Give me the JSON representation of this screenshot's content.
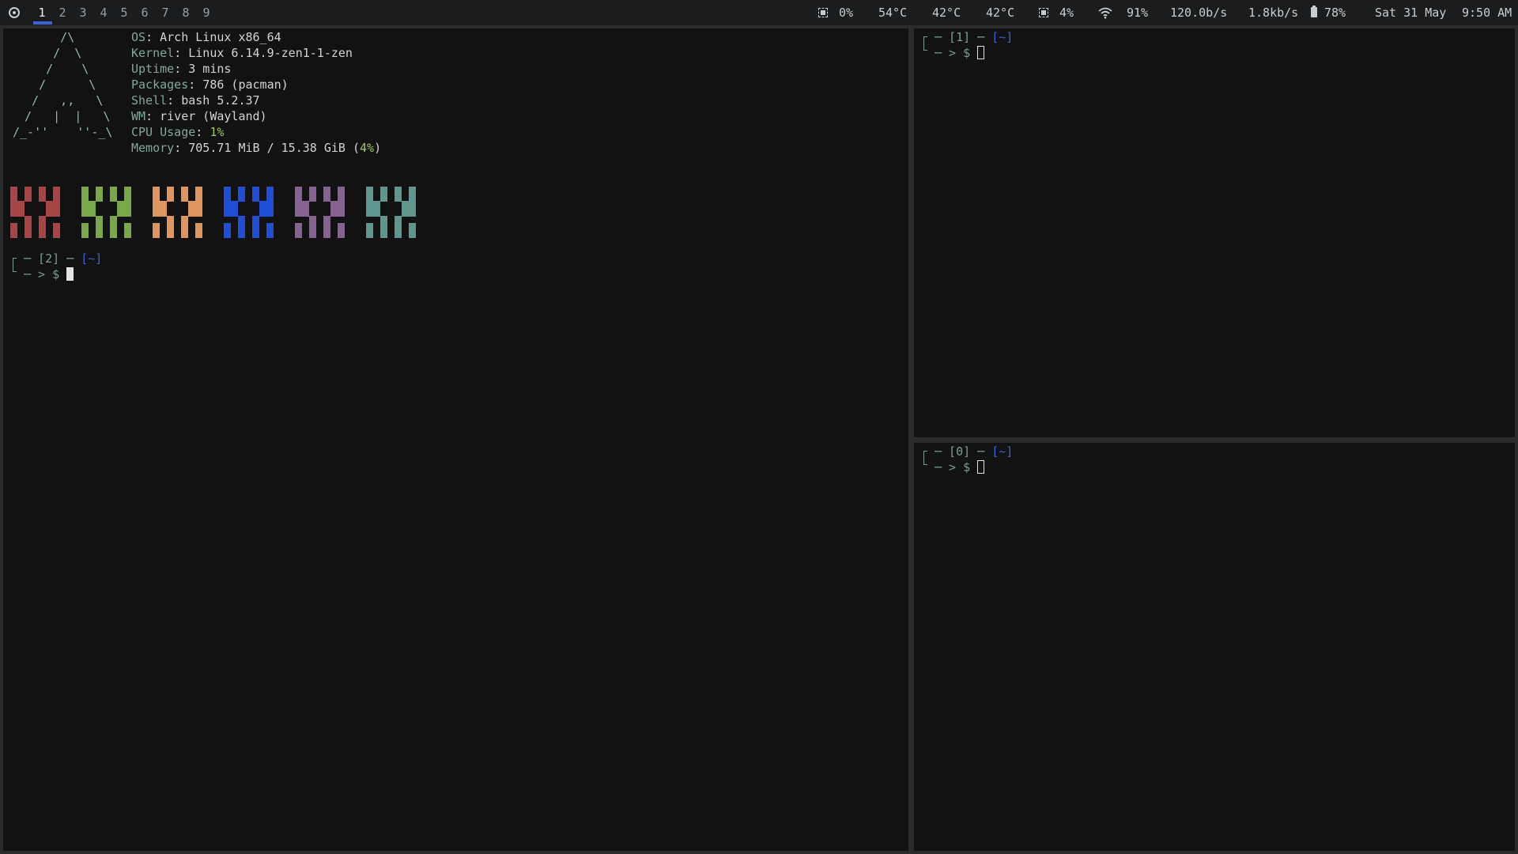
{
  "bar": {
    "menu_icon": "circle-dot-icon",
    "tags": [
      "1",
      "2",
      "3",
      "4",
      "5",
      "6",
      "7",
      "8",
      "9"
    ],
    "active_tag": "1",
    "cpu": "0%",
    "temps": [
      "54°C",
      "42°C",
      "42°C"
    ],
    "memory": "4%",
    "wifi": "91%",
    "net_down": "120.0b/s",
    "net_up": "1.8kb/s",
    "battery": "78%",
    "date": "Sat 31 May",
    "time": "9:50 AM",
    "colors": {
      "background": "#1b1c1d",
      "active_underline": "#3e62d1"
    }
  },
  "fetch": {
    "logo": [
      "      /\\",
      "     /  \\",
      "    /    \\",
      "   /      \\",
      "  /   ,,   \\",
      " /   |  |   \\",
      "/_-''    ''-_\\"
    ],
    "info": [
      {
        "key": "OS",
        "value": "Arch Linux x86_64"
      },
      {
        "key": "Kernel",
        "value": "Linux 6.14.9-zen1-1-zen"
      },
      {
        "key": "Uptime",
        "value": "3 mins"
      },
      {
        "key": "Packages",
        "value": "786 (pacman)"
      },
      {
        "key": "Shell",
        "value": "bash 5.2.37"
      },
      {
        "key": "WM",
        "value": "river (Wayland)"
      },
      {
        "key": "CPU Usage",
        "value": "1%"
      },
      {
        "key": "Memory",
        "value_prefix": "705.71 MiB / 15.38 GiB (",
        "value_pct": "4%",
        "value_suffix": ")"
      }
    ],
    "palette": [
      "#a84547",
      "#79a849",
      "#e0955e",
      "#1e4fd4",
      "#866293",
      "#5f9690"
    ]
  },
  "terminals": {
    "left": {
      "prompt_open": "─ [2] ─ ",
      "dir": "[~]",
      "prompt_line": "─ > $ "
    },
    "right_top": {
      "prompt_open": "─ [1] ─ ",
      "dir": "[~]",
      "prompt_line": "─ > $ "
    },
    "right_bottom": {
      "prompt_open": "─ [0] ─ ",
      "dir": "[~]",
      "prompt_line": "─ > $ "
    }
  }
}
